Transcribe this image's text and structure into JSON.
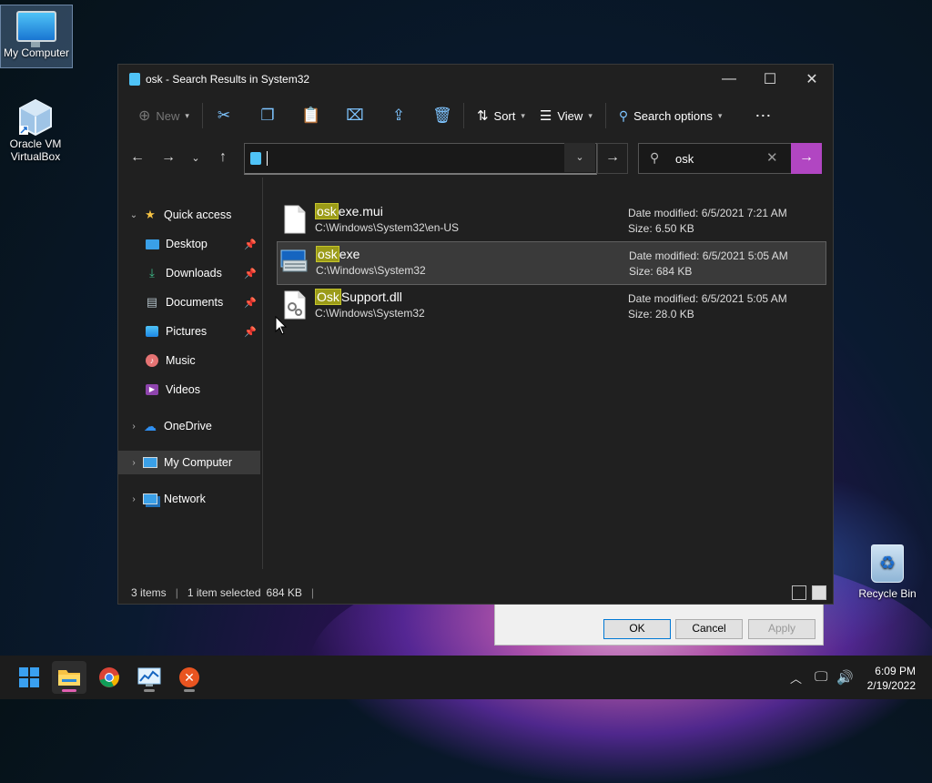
{
  "desktop": {
    "icons": [
      {
        "label": "My Computer"
      },
      {
        "label": "Oracle VM VirtualBox"
      },
      {
        "label": "Recycle Bin"
      }
    ]
  },
  "dialog": {
    "ok": "OK",
    "cancel": "Cancel",
    "apply": "Apply"
  },
  "window": {
    "title": "osk - Search Results in System32",
    "toolbar": {
      "new_label": "New",
      "sort_label": "Sort",
      "view_label": "View",
      "search_options_label": "Search options"
    },
    "address": {
      "value": ""
    },
    "search": {
      "value": "osk"
    },
    "sidebar": {
      "quick_access": "Quick access",
      "items": [
        "Desktop",
        "Downloads",
        "Documents",
        "Pictures",
        "Music",
        "Videos"
      ],
      "onedrive": "OneDrive",
      "my_computer": "My Computer",
      "network": "Network"
    },
    "files": [
      {
        "hl": "osk",
        "rest": "exe.mui",
        "path": "C:\\Windows\\System32\\en-US",
        "modified": "Date modified: 6/5/2021 7:21 AM",
        "size": "Size: 6.50 KB"
      },
      {
        "hl": "osk",
        "rest": "exe",
        "path": "C:\\Windows\\System32",
        "modified": "Date modified: 6/5/2021 5:05 AM",
        "size": "Size: 684 KB"
      },
      {
        "hl": "Osk",
        "rest": "Support.dll",
        "path": "C:\\Windows\\System32",
        "modified": "Date modified: 6/5/2021 5:05 AM",
        "size": "Size: 28.0 KB"
      }
    ],
    "status": {
      "items": "3 items",
      "selected": "1 item selected",
      "size": "684 KB"
    }
  },
  "taskbar": {
    "time": "6:09 PM",
    "date": "2/19/2022"
  },
  "colors": {
    "accent": "#b146c2",
    "highlight": "#9b9b18",
    "folder": "#4fc3f7"
  }
}
